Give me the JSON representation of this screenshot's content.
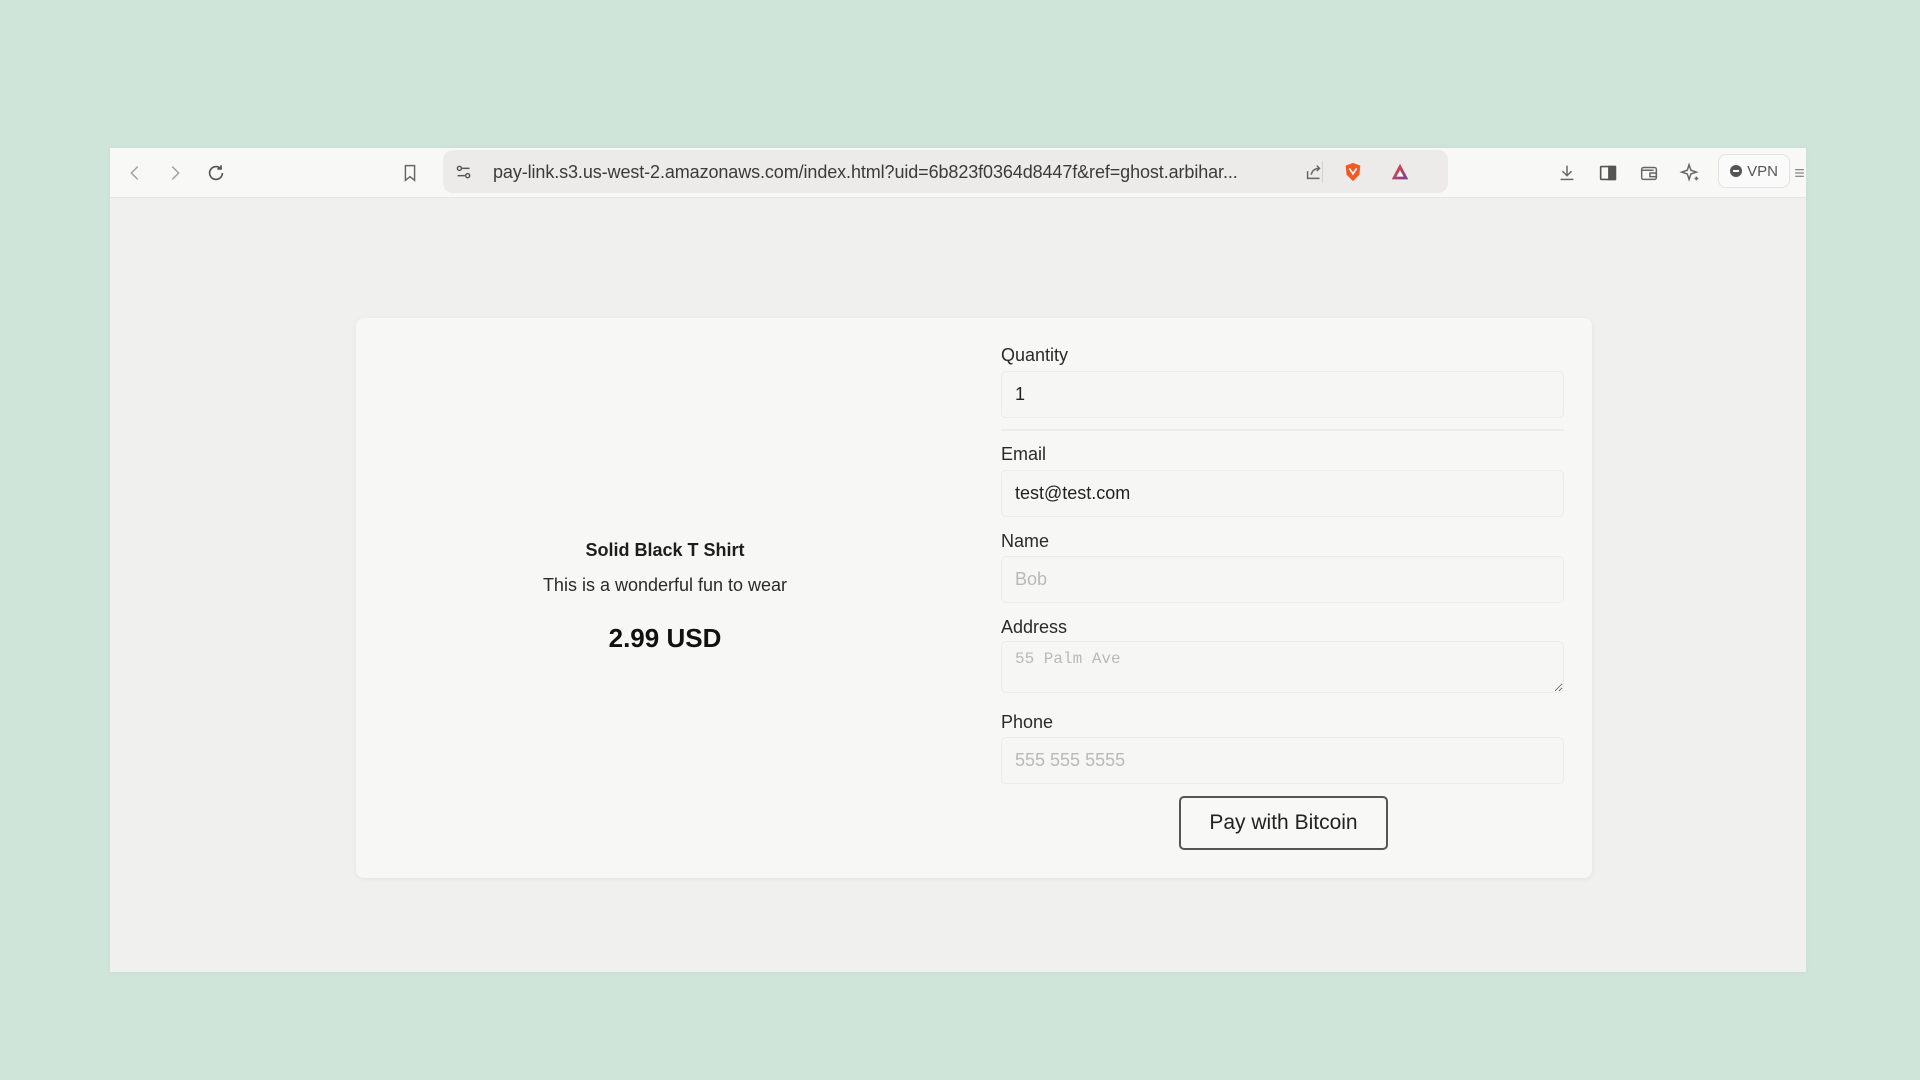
{
  "browser": {
    "url": "pay-link.s3.us-west-2.amazonaws.com/index.html?uid=6b823f0364d8447f&ref=ghost.arbihar...",
    "vpn_label": "VPN",
    "icons": [
      "back-icon",
      "forward-icon",
      "reload-icon",
      "bookmark-icon",
      "site-settings-icon",
      "share-icon",
      "brave-shields-icon",
      "brave-rewards-icon",
      "download-icon",
      "sidebar-icon",
      "wallet-icon",
      "leo-ai-icon",
      "vpn-icon",
      "menu-icon"
    ],
    "colors": {
      "shields": "#f15a24",
      "rewards_start": "#ff4724",
      "rewards_end": "#6b3fa0"
    }
  },
  "product": {
    "name": "Solid Black T Shirt",
    "description": "This is a wonderful fun to wear",
    "price": "2.99 USD"
  },
  "form": {
    "quantity": {
      "label": "Quantity",
      "value": "1"
    },
    "email": {
      "label": "Email",
      "value": "test@test.com"
    },
    "name": {
      "label": "Name",
      "placeholder": "Bob"
    },
    "address": {
      "label": "Address",
      "placeholder": "55 Palm Ave"
    },
    "phone": {
      "label": "Phone",
      "placeholder": "555 555 5555"
    },
    "submit_label": "Pay with Bitcoin"
  }
}
